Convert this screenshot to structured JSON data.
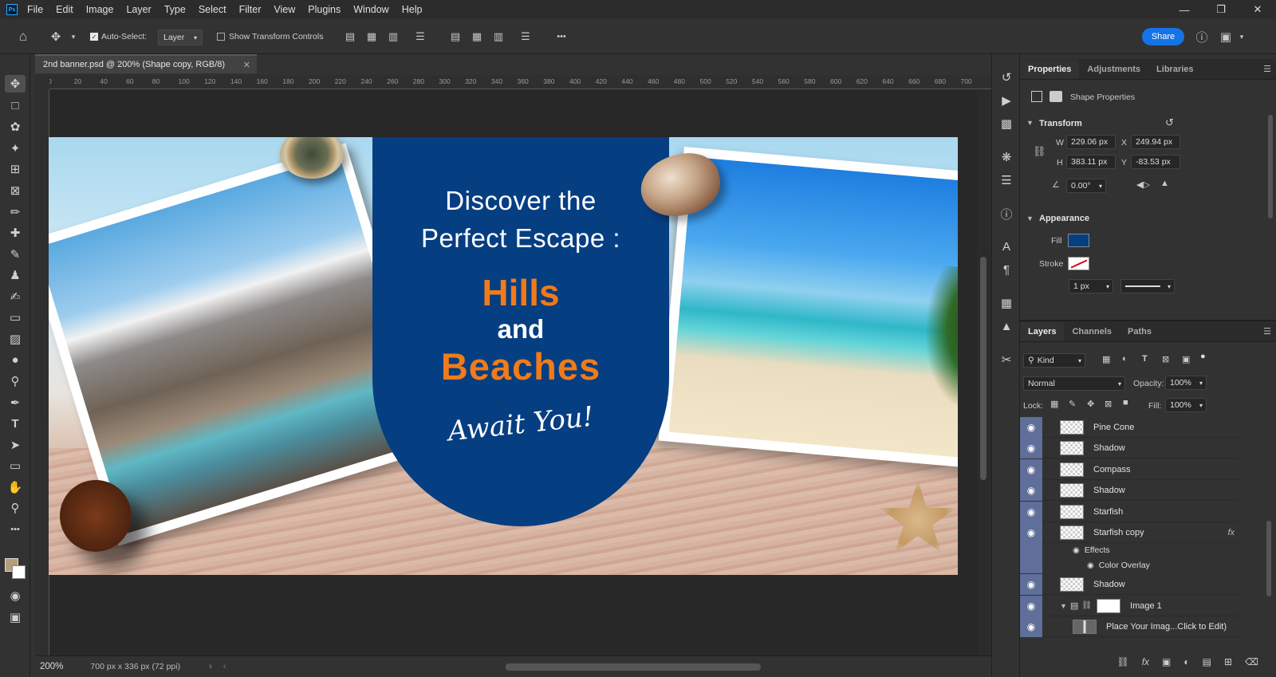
{
  "app": {
    "logo": "Ps",
    "menu": [
      "File",
      "Edit",
      "Image",
      "Layer",
      "Type",
      "Select",
      "Filter",
      "View",
      "Plugins",
      "Window",
      "Help"
    ]
  },
  "options": {
    "auto_select_label": "Auto-Select:",
    "auto_select_value": "Layer",
    "show_transform_label": "Show Transform Controls",
    "more": "•••",
    "share_label": "Share"
  },
  "document": {
    "tab_title": "2nd banner.psd @ 200% (Shape copy, RGB/8)",
    "zoom": "200%",
    "doc_info": "700 px x 336 px (72 ppi)",
    "ruler_h": [
      "0",
      "20",
      "40",
      "60",
      "80",
      "100",
      "120",
      "140",
      "160",
      "180",
      "200",
      "220",
      "240",
      "260",
      "280",
      "300",
      "320",
      "340",
      "360",
      "380",
      "400",
      "420",
      "440",
      "460",
      "480",
      "500",
      "520",
      "540",
      "560",
      "580",
      "600",
      "620",
      "640",
      "660",
      "680",
      "700"
    ]
  },
  "banner": {
    "line1": "Discover the",
    "line2": "Perfect Escape :",
    "hills": "Hills",
    "and": "and",
    "beaches": "Beaches",
    "await": "Await You!",
    "arch_color": "#063e82",
    "accent_color": "#f07b1a"
  },
  "properties": {
    "tabs": [
      "Properties",
      "Adjustments",
      "Libraries"
    ],
    "shape_label": "Shape Properties",
    "transform_title": "Transform",
    "w_label": "W",
    "w": "229.06 px",
    "x_label": "X",
    "x": "249.94 px",
    "h_label": "H",
    "h": "383.11 px",
    "y_label": "Y",
    "y": "-83.53 px",
    "angle": "0.00°",
    "appearance_title": "Appearance",
    "fill_label": "Fill",
    "fill_color": "#063e82",
    "stroke_label": "Stroke",
    "stroke_width": "1 px"
  },
  "layers": {
    "tabs": [
      "Layers",
      "Channels",
      "Paths"
    ],
    "kind_label": "Kind",
    "blend_mode": "Normal",
    "opacity_label": "Opacity:",
    "opacity": "100%",
    "lock_label": "Lock:",
    "fill_label": "Fill:",
    "fill": "100%",
    "items": [
      "Pine Cone",
      "Shadow",
      "Compass",
      "Shadow",
      "Starfish",
      "Starfish copy",
      "Shadow",
      "Image 1",
      "Place Your Imag...Click to Edit)"
    ],
    "effects_label": "Effects",
    "color_overlay_label": "Color Overlay",
    "fx_label": "fx"
  }
}
